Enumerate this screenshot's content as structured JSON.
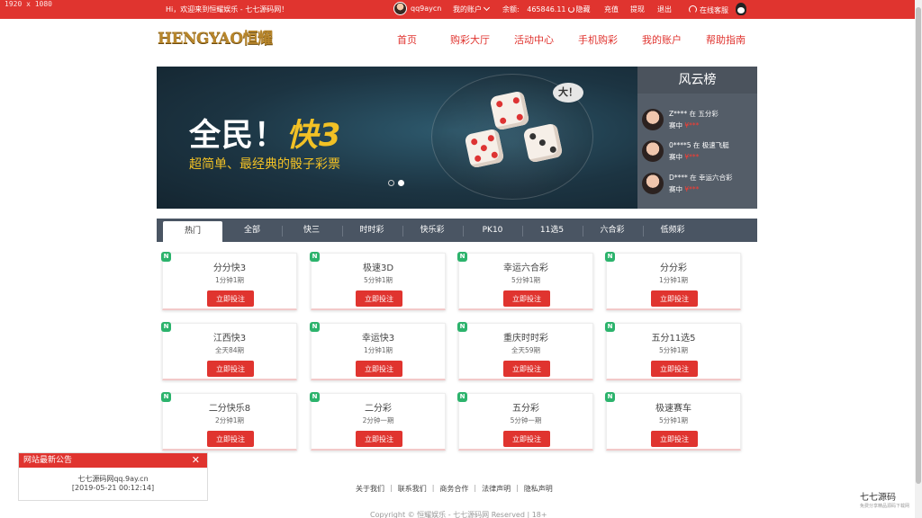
{
  "topbar": {
    "resolution": "1920 x 1080",
    "welcome": "Hi，欢迎来到恒耀娱乐 - 七七源码网！",
    "username": "qq9aycn",
    "my_account": "我的账户",
    "balance_label": "余额:",
    "balance_value": "465846.11",
    "hide": "隐藏",
    "recharge": "充值",
    "withdraw": "提现",
    "logout": "退出",
    "service": "在线客服"
  },
  "header": {
    "logo": "HENGYAO恒耀",
    "nav": [
      "首页",
      "购彩大厅",
      "活动中心",
      "手机购彩",
      "我的账户",
      "帮助指南"
    ]
  },
  "banner": {
    "headline_a": "全民！",
    "headline_b": "快3",
    "subline": "超简单、最经典的骰子彩票",
    "bubble": "大！",
    "active_slide": 2,
    "slides": 2
  },
  "ranking": {
    "title": "风云榜",
    "entries": [
      {
        "line1": "Z**** 在 五分彩",
        "line2": "赛中",
        "amount": "¥***"
      },
      {
        "line1": "0****5 在 极速飞艇",
        "line2": "赛中",
        "amount": "¥***"
      },
      {
        "line1": "D**** 在 幸运六合彩",
        "line2": "赛中",
        "amount": "¥***"
      }
    ]
  },
  "tabs": [
    "热门",
    "全部",
    "快三",
    "时时彩",
    "快乐彩",
    "PK10",
    "11选5",
    "六合彩",
    "低频彩"
  ],
  "games": [
    {
      "name": "分分快3",
      "freq": "1分钟1期"
    },
    {
      "name": "极速3D",
      "freq": "5分钟1期"
    },
    {
      "name": "幸运六合彩",
      "freq": "5分钟1期"
    },
    {
      "name": "分分彩",
      "freq": "1分钟1期"
    },
    {
      "name": "江西快3",
      "freq": "全天84期"
    },
    {
      "name": "幸运快3",
      "freq": "1分钟1期"
    },
    {
      "name": "重庆时时彩",
      "freq": "全天59期"
    },
    {
      "name": "五分11选5",
      "freq": "5分钟1期"
    },
    {
      "name": "二分快乐8",
      "freq": "2分钟1期"
    },
    {
      "name": "二分彩",
      "freq": "2分钟一期"
    },
    {
      "name": "五分彩",
      "freq": "5分钟一期"
    },
    {
      "name": "极速赛车",
      "freq": "5分钟1期"
    }
  ],
  "bet_label": "立即投注",
  "new_badge": "N",
  "notice": {
    "title": "网站最新公告",
    "close": "✕",
    "text": "七七源码网qq.9ay.cn",
    "date": "[2019-05-21 00:12:14]"
  },
  "footer": {
    "links": [
      "关于我们",
      "联系我们",
      "商务合作",
      "法律声明",
      "隐私声明"
    ],
    "copyright": "Copyright © 恒耀娱乐 - 七七源码网 Reserved | 18+"
  },
  "watermark": {
    "text": "七七源码",
    "sub": "免费分享精品源码下载网"
  }
}
